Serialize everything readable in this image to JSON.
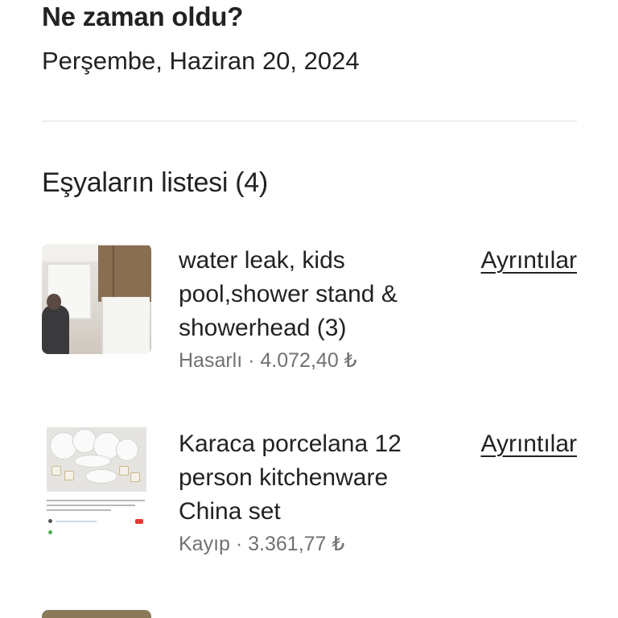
{
  "when": {
    "title": "Ne zaman oldu?",
    "date": "Perşembe, Haziran 20, 2024"
  },
  "items_section": {
    "title": "Eşyaların listesi (4)"
  },
  "items": [
    {
      "title": "water leak, kids pool,shower stand & showerhead (3)",
      "meta": "Hasarlı · 4.072,40 ₺",
      "details_label": "Ayrıntılar",
      "thumbnail": "room-photo"
    },
    {
      "title": "Karaca porcelana 12 person kitchenware China set",
      "meta": "Kayıp · 3.361,77 ₺",
      "details_label": "Ayrıntılar",
      "thumbnail": "product-listing-screenshot"
    }
  ],
  "colors": {
    "text_primary": "#222222",
    "text_secondary": "#717171",
    "divider": "#dddddd"
  }
}
